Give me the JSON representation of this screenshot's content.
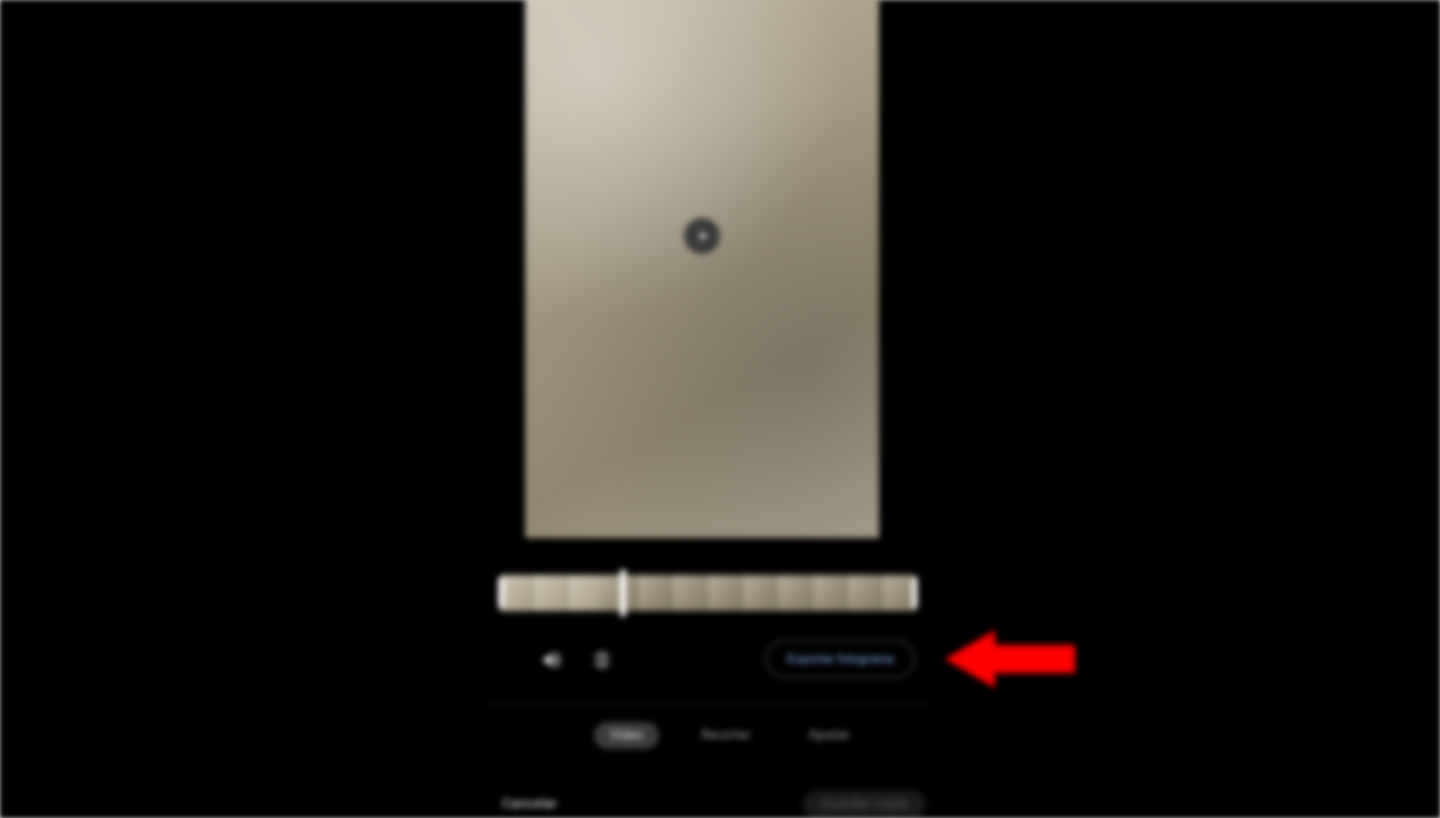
{
  "preview": {
    "play_label": "Play"
  },
  "timeline": {
    "frame_count": 12
  },
  "tools": {
    "sound_icon": "sound",
    "stabilize_icon": "stabilize"
  },
  "export": {
    "label": "Exportar fotograma"
  },
  "tabs": {
    "items": [
      {
        "label": "Video",
        "active": true
      },
      {
        "label": "Recortar",
        "active": false
      },
      {
        "label": "Ajustar",
        "active": false
      }
    ]
  },
  "footer": {
    "cancel": "Cancelar",
    "save": "Guardar copia"
  },
  "annotation": {
    "arrow_color": "#ff0000"
  }
}
